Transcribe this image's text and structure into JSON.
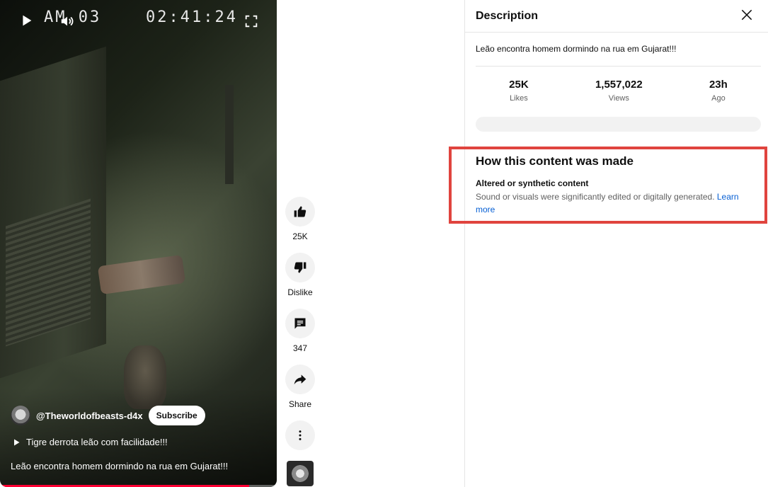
{
  "video": {
    "overlay_am": "AM 03",
    "overlay_clock": "02:41:24",
    "channel_name": "@Theworldofbeasts-d4x",
    "subscribe_label": "Subscribe",
    "next_title": "Tigre derrota leão com facilidade!!!",
    "caption": "Leão encontra homem dormindo na rua em Gujarat!!!",
    "progress": 0.9
  },
  "actions": {
    "like_label": "25K",
    "dislike_label": "Dislike",
    "comments_label": "347",
    "share_label": "Share"
  },
  "description": {
    "title": "Description",
    "text": "Leão encontra homem dormindo na rua em Gujarat!!!",
    "stats": [
      {
        "value": "25K",
        "caption": "Likes"
      },
      {
        "value": "1,557,022",
        "caption": "Views"
      },
      {
        "value": "23h",
        "caption": "Ago"
      }
    ],
    "made": {
      "title": "How this content was made",
      "subtitle": "Altered or synthetic content",
      "body": "Sound or visuals were significantly edited or digitally generated.",
      "link": "Learn more"
    }
  },
  "colors": {
    "highlight": "#e0443e",
    "link": "#065fd4",
    "progress": "#ff0033"
  }
}
